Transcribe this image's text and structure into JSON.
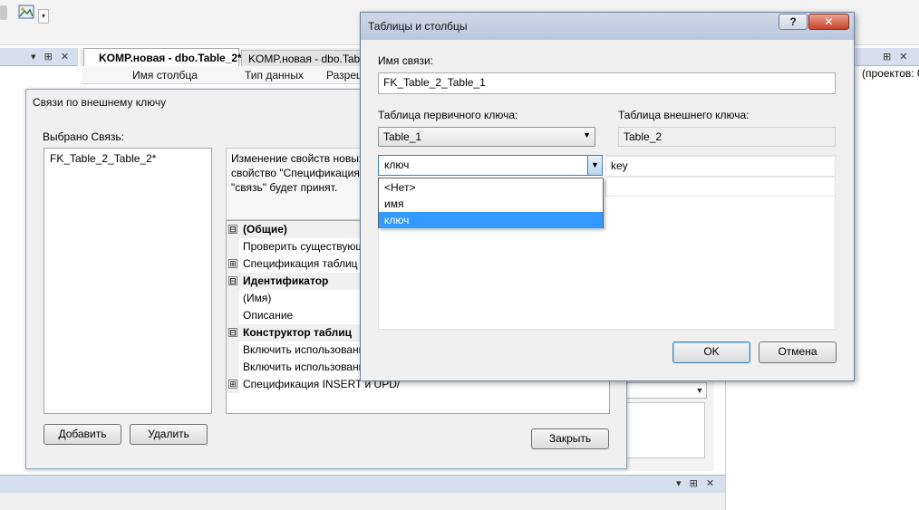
{
  "ide": {
    "toolbar_dropdown_glyph": "▾",
    "left_panel_glyphs": "▾ ⊞ ✕",
    "right_panel_glyphs": "⊞ ✕",
    "bottom_panel_glyphs": "▾ ⊞ ✕",
    "doc_tabs": [
      "KOMP.новая - dbo.Table_2*",
      "KOMP.новая - dbo.Tab"
    ],
    "grid_headers": [
      "Имя столбца",
      "Тип данных",
      "Разреш"
    ],
    "right_panel_text": "(проектов: 0"
  },
  "fk_dialog": {
    "title": "Связи по внешнему ключу",
    "selected_label": "Выбрано Связь:",
    "relations": [
      "FK_Table_2_Table_2*"
    ],
    "description": "Изменение свойств новых\nсвойство \"Спецификация\n\"связь\" будет принят.",
    "properties": [
      {
        "kind": "category",
        "toggle": "⊟",
        "label": "(Общие)"
      },
      {
        "kind": "item",
        "toggle": "",
        "label": "Проверить существующ"
      },
      {
        "kind": "item",
        "toggle": "⊞",
        "label": "Спецификация таблиц и"
      },
      {
        "kind": "category",
        "toggle": "⊟",
        "label": "Идентификатор"
      },
      {
        "kind": "item",
        "toggle": "",
        "label": "(Имя)"
      },
      {
        "kind": "item",
        "toggle": "",
        "label": "Описание"
      },
      {
        "kind": "category",
        "toggle": "⊟",
        "label": "Конструктор таблиц"
      },
      {
        "kind": "item",
        "toggle": "",
        "label": "Включить использовани"
      },
      {
        "kind": "item",
        "toggle": "",
        "label": "Включить использовани"
      },
      {
        "kind": "item",
        "toggle": "⊞",
        "label": "Спецификация INSERT и UPD/"
      }
    ],
    "buttons": {
      "add": "Добавить",
      "delete": "Удалить",
      "close": "Закрыть"
    }
  },
  "tc_dialog": {
    "title": "Таблицы и столбцы",
    "help_glyph": "?",
    "close_glyph": "✕",
    "relation_name_label": "Имя связи:",
    "relation_name_value": "FK_Table_2_Table_1",
    "pk_table_label": "Таблица первичного ключа:",
    "pk_table_value": "Table_1",
    "fk_table_label": "Таблица внешнего ключа:",
    "fk_table_value": "Table_2",
    "pk_column_value": "ключ",
    "fk_column_value": "key",
    "dropdown_options": [
      "<Нет>",
      "имя",
      "ключ"
    ],
    "dropdown_selected": "ключ",
    "buttons": {
      "ok": "OK",
      "cancel": "Отмена"
    }
  }
}
